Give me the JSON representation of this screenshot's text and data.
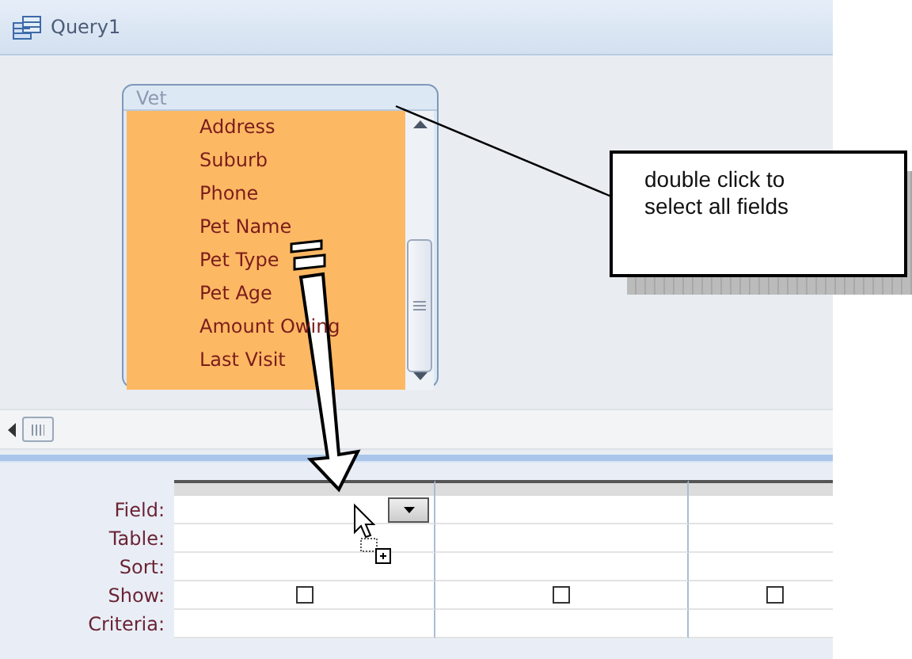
{
  "window": {
    "title": "Query1"
  },
  "field_list": {
    "title": "Vet",
    "fields": [
      "Address",
      "Suburb",
      "Phone",
      "Pet Name",
      "Pet Type",
      "Pet Age",
      "Amount Owing",
      "Last Visit"
    ]
  },
  "callout": {
    "text": "double click to select all fields"
  },
  "grid": {
    "row_labels": [
      "Field:",
      "Table:",
      "Sort:",
      "Show:",
      "Criteria:"
    ],
    "columns": [
      {
        "active": true,
        "show_checked": false
      },
      {
        "active": false,
        "show_checked": false
      },
      {
        "active": false,
        "show_checked": false
      }
    ]
  }
}
